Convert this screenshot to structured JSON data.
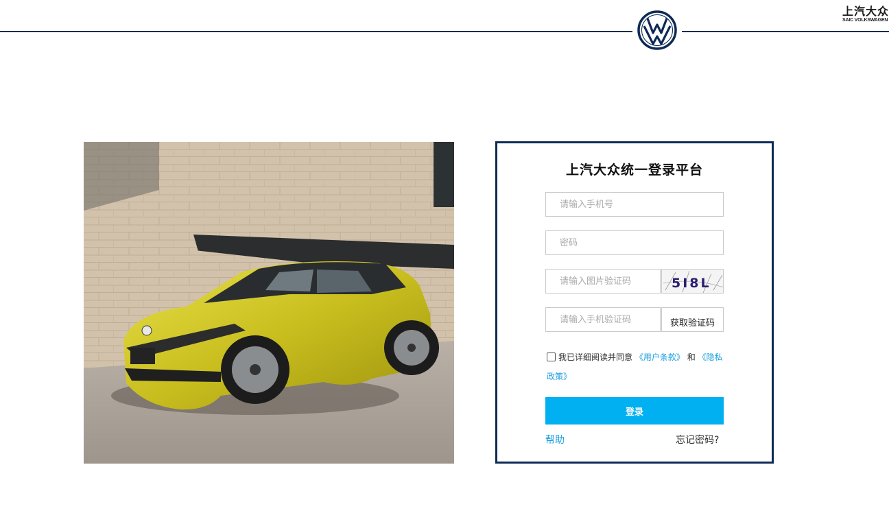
{
  "header": {
    "brand_cn": "上汽大众",
    "brand_en": "SAIC VOLKSWAGEN"
  },
  "login": {
    "title": "上汽大众统一登录平台",
    "phone_placeholder": "请输入手机号",
    "password_placeholder": "密码",
    "captcha_placeholder": "请输入图片验证码",
    "captcha_text": "5I8L",
    "sms_placeholder": "请输入手机验证码",
    "sms_button": "获取验证码",
    "agreement_prefix": "我已详细阅读并同意",
    "terms_link": "《用户条款》",
    "agreement_and": "和",
    "privacy_link": "《隐私政策》",
    "submit": "登录",
    "help": "帮助",
    "forgot": "忘记密码?"
  },
  "colors": {
    "navy": "#0e2a55",
    "accent": "#00b0f0",
    "link": "#1a9fe0"
  }
}
